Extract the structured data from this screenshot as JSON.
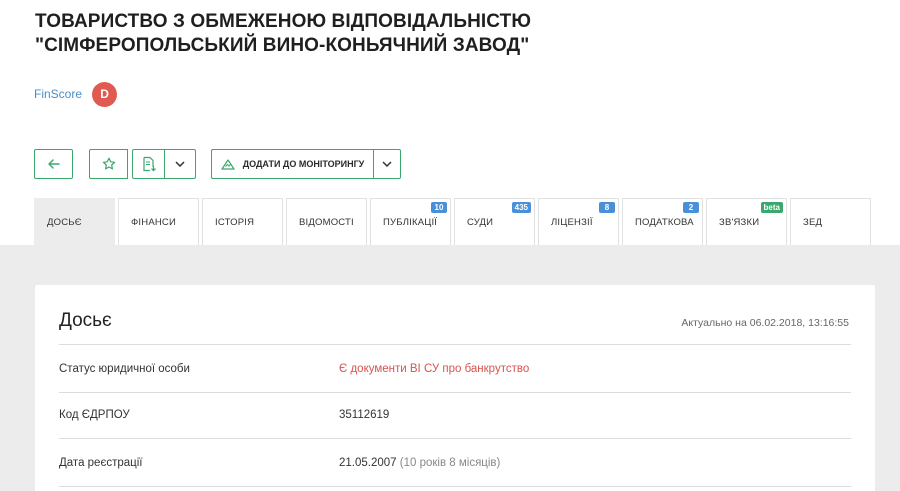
{
  "company": {
    "title_line1": "ТОВАРИСТВО З ОБМЕЖЕНОЮ ВІДПОВІДАЛЬНІСТЮ",
    "title_line2": "\"СІМФЕРОПОЛЬСЬКИЙ ВИНО-КОНЬЯЧНИЙ ЗАВОД\""
  },
  "finscore": {
    "label": "FinScore",
    "grade": "D",
    "grade_color": "#e05a52"
  },
  "toolbar": {
    "back_icon": "arrow-left-icon",
    "star_icon": "star-icon",
    "doc_icon": "document-download-icon",
    "caret_icon": "chevron-down-icon",
    "monitor_icon": "monitoring-icon",
    "monitor_label": "ДОДАТИ ДО МОНІТОРИНГУ",
    "accent_color": "#3aa76d"
  },
  "tabs": [
    {
      "label": "ДОСЬЄ",
      "badge": "",
      "active": true
    },
    {
      "label": "ФІНАНСИ",
      "badge": ""
    },
    {
      "label": "ІСТОРІЯ",
      "badge": ""
    },
    {
      "label": "ВІДОМОСТІ",
      "badge": ""
    },
    {
      "label": "ПУБЛІКАЦІЇ",
      "badge": "10"
    },
    {
      "label": "СУДИ",
      "badge": "435"
    },
    {
      "label": "ЛІЦЕНЗІЇ",
      "badge": "8"
    },
    {
      "label": "ПОДАТКОВА",
      "badge": "2"
    },
    {
      "label": "ЗВ'ЯЗКИ",
      "badge": "beta",
      "badge_color": "#3aa76d"
    },
    {
      "label": "ЗЕД",
      "badge": ""
    }
  ],
  "dossier": {
    "title": "Досьє",
    "updated": "Актуально на 06.02.2018, 13:16:55",
    "rows": [
      {
        "label": "Статус юридичної особи",
        "value": "Є документи ВІ СУ про банкрутство",
        "value_color": "#d9534f"
      },
      {
        "label": "Код ЄДРПОУ",
        "value": "35112619"
      },
      {
        "label": "Дата реєстрації",
        "value": "21.05.2007",
        "extra": "(10 років 8 місяців)"
      }
    ]
  }
}
